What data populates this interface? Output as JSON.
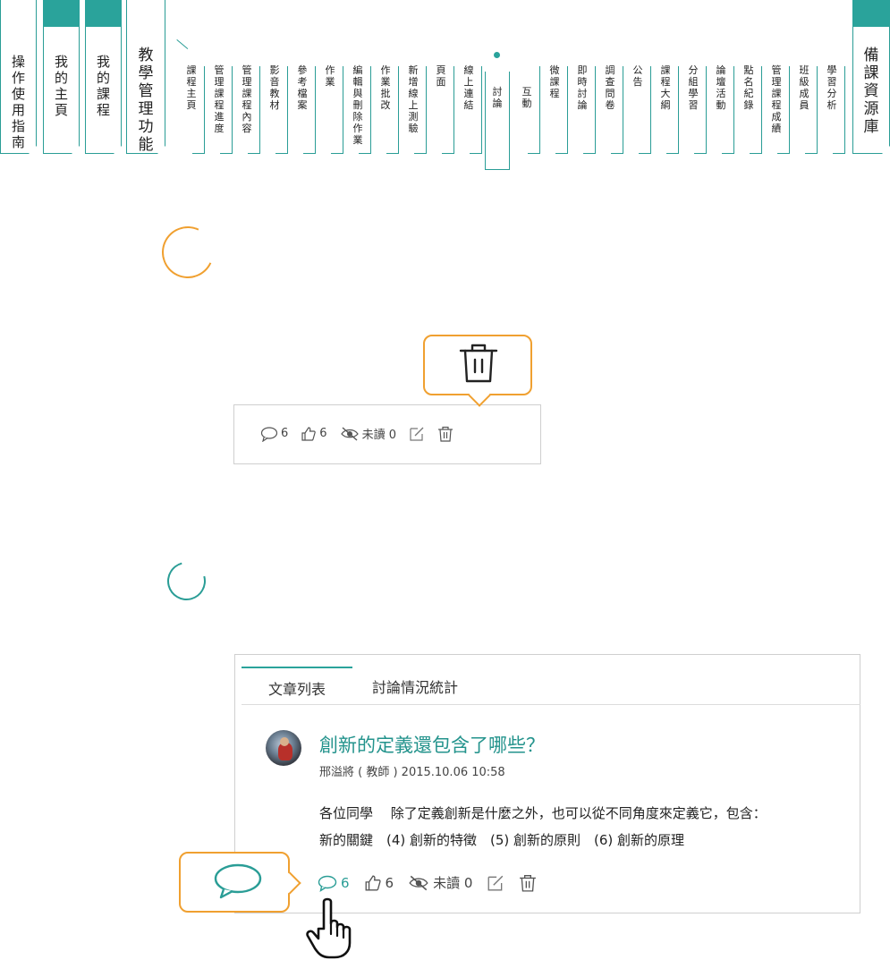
{
  "left_tabs": [
    {
      "label": "操\n作\n使\n用\n指\n南"
    },
    {
      "label": "我\n的\n主\n頁"
    },
    {
      "label": "我\n的\n課\n程"
    },
    {
      "label": "教\n學\n管\n理\n功\n能"
    }
  ],
  "right_tab": {
    "label": "備\n課\n資\n源\n庫"
  },
  "menu": [
    {
      "label": "課\n程\n主\n頁"
    },
    {
      "label": "管\n理\n課\n程\n進\n度"
    },
    {
      "label": "管\n理\n課\n程\n內\n容"
    },
    {
      "label": "影\n音\n教\n材"
    },
    {
      "label": "參\n考\n檔\n案"
    },
    {
      "label": "作\n業"
    },
    {
      "label": "編\n輯\n與\n刪\n除\n作\n業"
    },
    {
      "label": "作\n業\n批\n改"
    },
    {
      "label": "新\n增\n線\n上\n測\n驗"
    },
    {
      "label": "頁\n面"
    },
    {
      "label": "線\n上\n連\n結"
    },
    {
      "label": "討\n論"
    },
    {
      "label": "互\n動"
    },
    {
      "label": "微\n課\n程"
    },
    {
      "label": "即\n時\n討\n論"
    },
    {
      "label": "調\n查\n問\n卷"
    },
    {
      "label": "公\n告"
    },
    {
      "label": "課\n程\n大\n綱"
    },
    {
      "label": "分\n組\n學\n習"
    },
    {
      "label": "論\n壇\n活\n動"
    },
    {
      "label": "點\n名\n紀\n錄"
    },
    {
      "label": "管\n理\n課\n程\n成\n績"
    },
    {
      "label": "班\n級\n成\n員"
    },
    {
      "label": "學\n習\n分\n析"
    }
  ],
  "toolbar_example": {
    "comments": "6",
    "likes": "6",
    "unread": "未讀 0",
    "icons": [
      "comment-icon",
      "thumb-up-icon",
      "eye-unread-icon",
      "edit-icon",
      "trash-icon"
    ]
  },
  "article_panel": {
    "tabs": [
      "文章列表",
      "討論情況統計"
    ],
    "post": {
      "title": "創新的定義還包含了哪些？",
      "meta": "邢溢將 ( 教師 ) 2015.10.06 10:58",
      "body_line1": "各位同學　  除了定義創新是什麼之外，也可以從不同角度來定義它，包含：",
      "body_line2": "新的關鍵　(4) 創新的特徵　(5) 創新的原則　(6) 創新的原理",
      "comments": "6",
      "likes": "6",
      "unread": "未讀 0"
    }
  },
  "colors": {
    "accent": "#2aa39b",
    "highlight": "#f0a030"
  }
}
